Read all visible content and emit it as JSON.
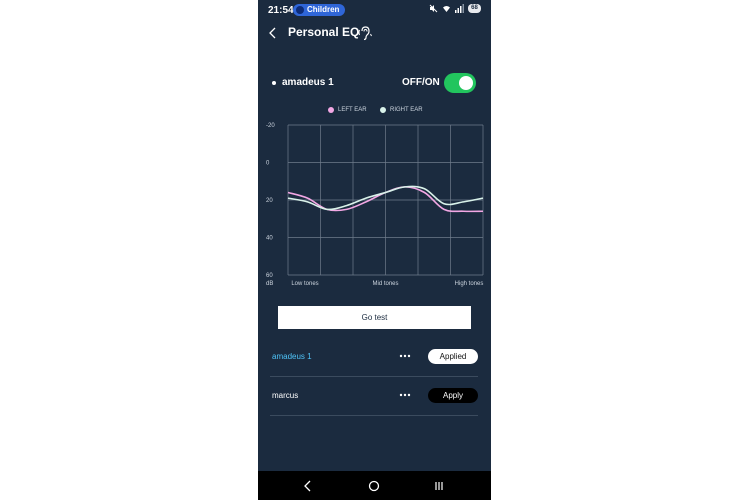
{
  "status_bar": {
    "time": "21:54",
    "profile_pill": "Children",
    "battery": "68"
  },
  "header": {
    "title": "Personal EQ"
  },
  "profile": {
    "name": "amadeus 1",
    "toggle_label": "OFF/ON",
    "toggle_on": true
  },
  "colors": {
    "background": "#1b2b3f",
    "accent_blue": "#4fc3f7",
    "toggle_green": "#22c55e",
    "left_ear": "#f2a7e4",
    "right_ear": "#d9f2ea"
  },
  "chart_data": {
    "type": "line",
    "series": [
      {
        "name": "LEFT EAR",
        "values": [
          16,
          19,
          25,
          25,
          21,
          16,
          13,
          16,
          25,
          26,
          26
        ]
      },
      {
        "name": "RIGHT EAR",
        "values": [
          19,
          21,
          25,
          23,
          19,
          16,
          13,
          14,
          22,
          21,
          19
        ]
      }
    ],
    "x": [
      0,
      1,
      2,
      3,
      4,
      5,
      6,
      7,
      8,
      9,
      10
    ],
    "x_tick_labels": [
      "Low tones",
      "Mid tones",
      "High tones"
    ],
    "y_ticks": [
      "-20",
      "0",
      "20",
      "40",
      "60"
    ],
    "y_unit": "dB",
    "ylim": [
      -20,
      60
    ],
    "y_inverted": true,
    "grid": true,
    "legend_position": "top"
  },
  "go_test_label": "Go test",
  "profiles": [
    {
      "name": "amadeus 1",
      "more_label": "•••",
      "button_label": "Applied",
      "state": "applied"
    },
    {
      "name": "marcus",
      "more_label": "•••",
      "button_label": "Apply",
      "state": "apply"
    }
  ],
  "icons": {
    "back": "chevron-left-icon",
    "hearing": "ear-icon",
    "more": "more-horizontal-icon",
    "nav_back": "nav-back-icon",
    "nav_home": "nav-home-icon",
    "nav_recents": "nav-recents-icon"
  }
}
